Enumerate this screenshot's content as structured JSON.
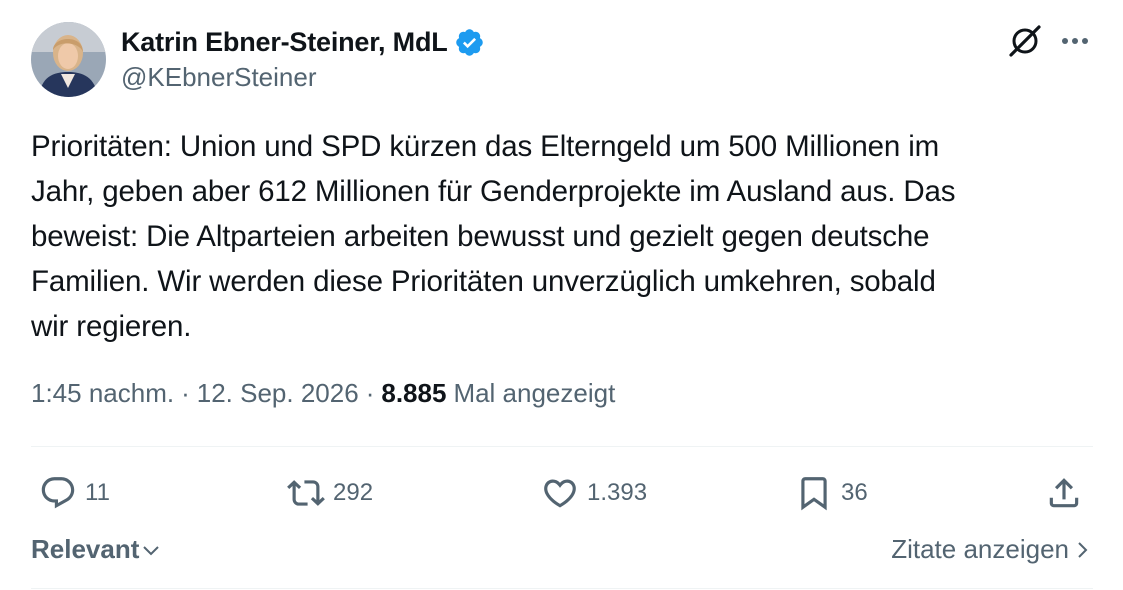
{
  "author": {
    "name": "Katrin Ebner-Steiner, MdL",
    "handle": "@KEbnerSteiner",
    "verified": true
  },
  "tweet": {
    "text": "Prioritäten: Union und SPD kürzen das Elterngeld um 500 Millionen im\nJahr, geben aber 612 Millionen für Genderprojekte im Ausland aus. Das\nbeweist: Die Altparteien arbeiten bewusst und gezielt gegen deutsche\nFamilien. Wir werden diese Prioritäten unverzüglich umkehren, sobald\nwir regieren.",
    "time": "1:45 nachm.",
    "date": "12. Sep. 2026",
    "separator": "·",
    "views_count": "8.885",
    "views_label": "Mal angezeigt"
  },
  "actions": {
    "replies": "11",
    "reposts": "292",
    "likes": "1.393",
    "bookmarks": "36"
  },
  "footer": {
    "sort_label": "Relevant",
    "quotes_label": "Zitate anzeigen"
  },
  "icons": {
    "header": [
      "grok-icon",
      "more-icon"
    ],
    "actions": [
      "reply-icon",
      "repost-icon",
      "like-icon",
      "bookmark-icon",
      "share-icon"
    ]
  },
  "colors": {
    "text": "#0f1419",
    "secondary": "#536471",
    "verified": "#1d9bf0",
    "divider": "#eff3f4"
  }
}
